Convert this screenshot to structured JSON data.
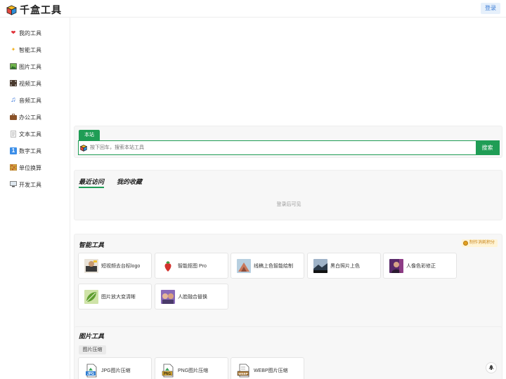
{
  "header": {
    "logo_text": "千盒工具",
    "login_label": "登录"
  },
  "sidebar": {
    "items": [
      {
        "icon": "heart-icon",
        "glyph": "❤",
        "label": "我的工具"
      },
      {
        "icon": "sparkles-icon",
        "glyph": "✨",
        "label": "智能工具"
      },
      {
        "icon": "picture-icon",
        "glyph": "▣",
        "label": "图片工具"
      },
      {
        "icon": "film-icon",
        "glyph": "▦",
        "label": "视频工具"
      },
      {
        "icon": "music-note-icon",
        "glyph": "♫",
        "label": "音频工具"
      },
      {
        "icon": "briefcase-icon",
        "glyph": "▰",
        "label": "办公工具"
      },
      {
        "icon": "document-icon",
        "glyph": "▤",
        "label": "文本工具"
      },
      {
        "icon": "number-icon",
        "glyph": "1",
        "label": "数字工具"
      },
      {
        "icon": "abacus-icon",
        "glyph": "▥",
        "label": "单位换算"
      },
      {
        "icon": "computer-icon",
        "glyph": "▭",
        "label": "开发工具"
      }
    ]
  },
  "search": {
    "tab_label": "本站",
    "placeholder": "按下回车，搜索本站工具",
    "button_label": "搜索"
  },
  "recent": {
    "tabs": [
      "最近访问",
      "我的收藏"
    ],
    "message": "登录后可见"
  },
  "ai_tools": {
    "title": "智能工具",
    "badge": "制作消耗积分",
    "items": [
      {
        "label": "短视频去台标logo",
        "icon": "video-logo-thumb"
      },
      {
        "label": "智能抠图 Pro",
        "icon": "strawberry-thumb"
      },
      {
        "label": "线稿上色智能绘制",
        "icon": "lineart-thumb"
      },
      {
        "label": "黑白照片上色",
        "icon": "landscape-thumb"
      },
      {
        "label": "人像色彩修正",
        "icon": "portrait-thumb"
      },
      {
        "label": "图片放大变清晰",
        "icon": "leaf-thumb"
      },
      {
        "label": "人脸融合替换",
        "icon": "faces-thumb"
      }
    ]
  },
  "image_tools": {
    "title": "图片工具",
    "subtag": "图片压缩",
    "items": [
      {
        "label": "JPG图片压缩",
        "icon": "jpg-file-icon"
      },
      {
        "label": "PNG图片压缩",
        "icon": "png-file-icon"
      },
      {
        "label": "WEBP图片压缩",
        "icon": "webp-file-icon"
      }
    ]
  },
  "colors": {
    "accent": "#1f9d55",
    "login_bg": "#e6f0fb",
    "badge_bg": "#fff4d6"
  }
}
